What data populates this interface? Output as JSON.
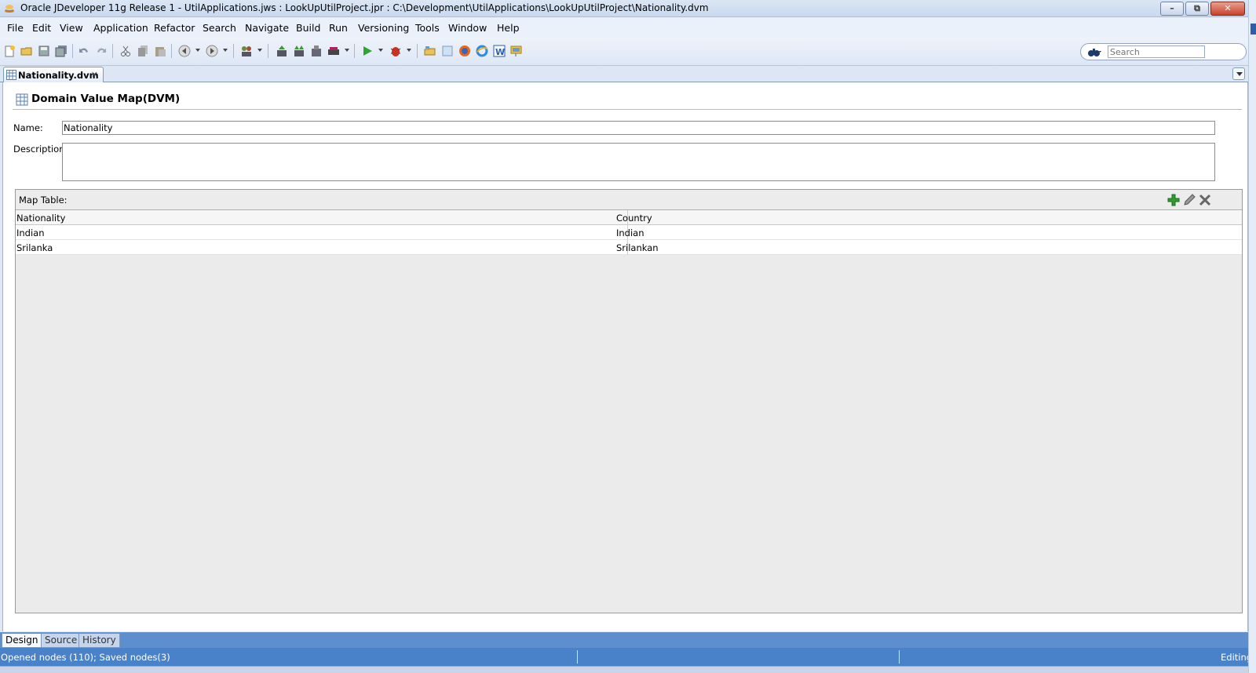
{
  "window": {
    "title": "Oracle JDeveloper 11g Release 1 - UtilApplications.jws : LookUpUtilProject.jpr : C:\\Development\\UtilApplications\\LookUpUtilProject\\Nationality.dvm",
    "minimize": "–",
    "maximize": "⧉",
    "close": "✕"
  },
  "menu": {
    "file": "File",
    "edit": "Edit",
    "view": "View",
    "application": "Application",
    "refactor": "Refactor",
    "search": "Search",
    "navigate": "Navigate",
    "build": "Build",
    "run": "Run",
    "versioning": "Versioning",
    "tools": "Tools",
    "window": "Window",
    "help": "Help"
  },
  "search": {
    "placeholder": "Search"
  },
  "tab": {
    "label": "Nationality.dvm",
    "close": "×"
  },
  "editor": {
    "title": "Domain Value Map(DVM)",
    "name_label": "Name:",
    "name_value": "Nationality",
    "description_label": "Description:",
    "description_value": "",
    "map_table_label": "Map Table:",
    "columns": [
      "Nationality",
      "Country"
    ],
    "rows": [
      [
        "Indian",
        "Indian"
      ],
      [
        "Srilanka",
        "Srilankan"
      ]
    ]
  },
  "bottom_tabs": {
    "design": "Design",
    "source": "Source",
    "history": "History"
  },
  "status": {
    "message": "Opened nodes (110); Saved nodes(3)",
    "mode": "Editing"
  },
  "colors": {
    "accent": "#4a82c9",
    "tab_active": "#f5f8fc",
    "add_green": "#2e9d2e"
  }
}
